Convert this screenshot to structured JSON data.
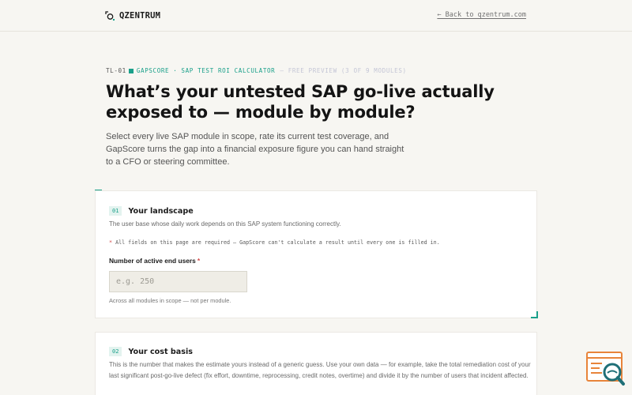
{
  "header": {
    "brand": "QZENTRUM",
    "back_link": "← Back to qzentrum.com"
  },
  "eyebrow": {
    "code": "TL-01",
    "main": "GAPSCORE",
    "separator": "·",
    "subtitle": "SAP TEST ROI CALCULATOR",
    "faded": "— FREE PREVIEW (3 OF 9 MODULES)"
  },
  "hero": {
    "title": "What’s your untested SAP go-live actually exposed to — module by module?",
    "lede": "Select every live SAP module in scope, rate its current test coverage, and GapScore turns the gap into a financial exposure figure you can hand straight to a CFO or steering committee."
  },
  "section1": {
    "number": "01",
    "title": "Your landscape",
    "description": "The user base whose daily work depends on this SAP system functioning correctly.",
    "required_star": "*",
    "required_note": "All fields on this page are required — GapScore can't calculate a result until every one is filled in.",
    "field_label": "Number of active end users",
    "field_star": "*",
    "field_placeholder": "e.g. 250",
    "field_value": "",
    "field_help": "Across all modules in scope — not per module."
  },
  "section2": {
    "number": "02",
    "title": "Your cost basis",
    "description": "This is the number that makes the estimate yours instead of a generic guess. Use your own data — for example, take the total remediation cost of your last significant post-go-live defect (fix effort, downtime, reprocessing, credit notes, overtime) and divide it by the number of users that incident affected."
  },
  "colors": {
    "accent": "#1aa08a",
    "required": "#d24a4a",
    "widget_orange": "#e8843a",
    "widget_teal": "#1f6f77"
  },
  "icons": {
    "logo": "qzentrum-logo-icon",
    "widget": "search-magnifier-widget-icon"
  }
}
